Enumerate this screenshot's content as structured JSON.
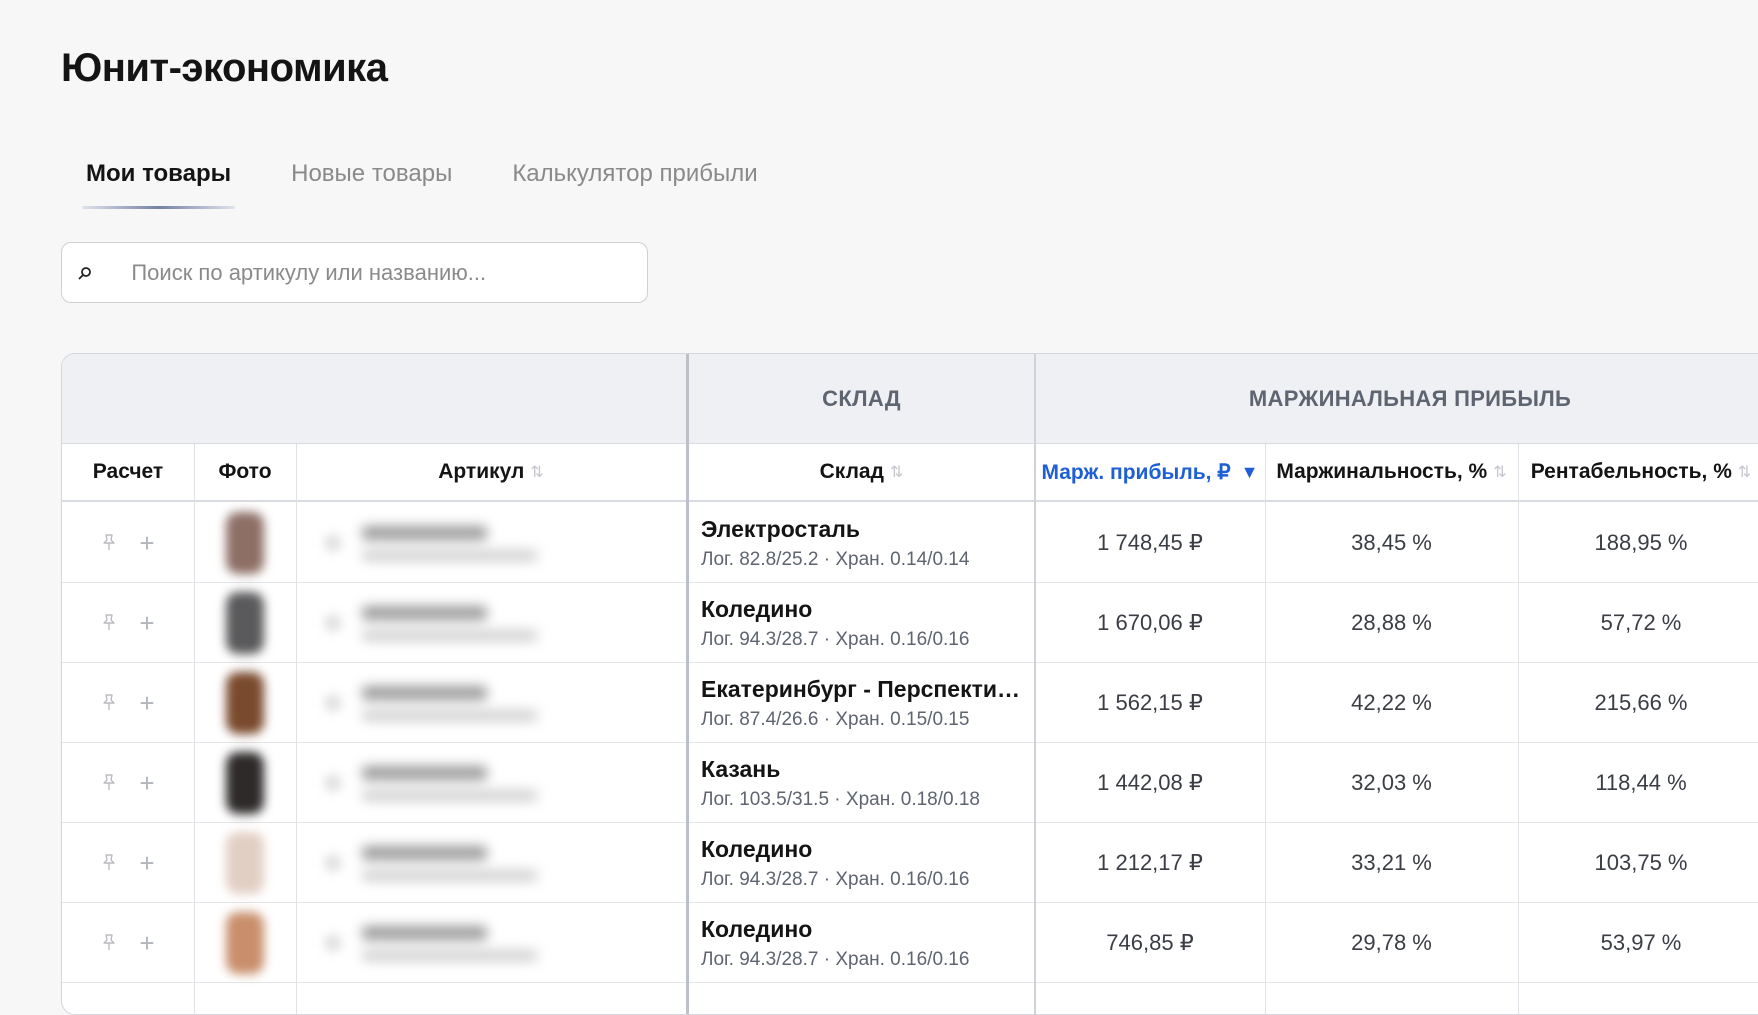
{
  "page": {
    "title": "Юнит-экономика"
  },
  "tabs": [
    {
      "label": "Мои товары",
      "active": true
    },
    {
      "label": "Новые товары",
      "active": false
    },
    {
      "label": "Калькулятор прибыли",
      "active": false
    }
  ],
  "search": {
    "placeholder": "Поиск по артикулу или названию...",
    "value": ""
  },
  "table": {
    "groups": {
      "warehouse": "СКЛАД",
      "margin": "МАРЖИНАЛЬНАЯ ПРИБЫЛЬ"
    },
    "headers": {
      "calc": "Расчет",
      "photo": "Фото",
      "article": "Артикул",
      "warehouse": "Склад",
      "margin_profit": "Марж. прибыль, ₽",
      "marginality": "Маржинальность, %",
      "profitability": "Рентабельность, %"
    },
    "sorted_column": "margin_profit",
    "sort_direction": "desc",
    "accent_color": "#1e5fd6",
    "rows": [
      {
        "warehouse": "Электросталь",
        "meta": "Лог. 82.8/25.2 · Хран. 0.14/0.14",
        "margin_profit": "1 748,45 ₽",
        "marginality": "38,45 %",
        "profitability": "188,95 %",
        "thumb_color": "#8d6f66"
      },
      {
        "warehouse": "Коледино",
        "meta": "Лог. 94.3/28.7 · Хран. 0.16/0.16",
        "margin_profit": "1 670,06 ₽",
        "marginality": "28,88 %",
        "profitability": "57,72 %",
        "thumb_color": "#5a5a5c"
      },
      {
        "warehouse": "Екатеринбург - Перспективный",
        "meta": "Лог. 87.4/26.6 · Хран. 0.15/0.15",
        "margin_profit": "1 562,15 ₽",
        "marginality": "42,22 %",
        "profitability": "215,66 %",
        "thumb_color": "#7a4a2e"
      },
      {
        "warehouse": "Казань",
        "meta": "Лог. 103.5/31.5 · Хран. 0.18/0.18",
        "margin_profit": "1 442,08 ₽",
        "marginality": "32,03 %",
        "profitability": "118,44 %",
        "thumb_color": "#2e2a2a"
      },
      {
        "warehouse": "Коледино",
        "meta": "Лог. 94.3/28.7 · Хран. 0.16/0.16",
        "margin_profit": "1 212,17 ₽",
        "marginality": "33,21 %",
        "profitability": "103,75 %",
        "thumb_color": "#e2cfc4"
      },
      {
        "warehouse": "Коледино",
        "meta": "Лог. 94.3/28.7 · Хран. 0.16/0.16",
        "margin_profit": "746,85 ₽",
        "marginality": "29,78 %",
        "profitability": "53,97 %",
        "thumb_color": "#c98f6c"
      }
    ]
  },
  "icons": {
    "search": "search-icon",
    "pin": "pin-icon",
    "add": "plus-icon",
    "sort": "sort-icon",
    "sort_active": "sort-desc-icon"
  }
}
